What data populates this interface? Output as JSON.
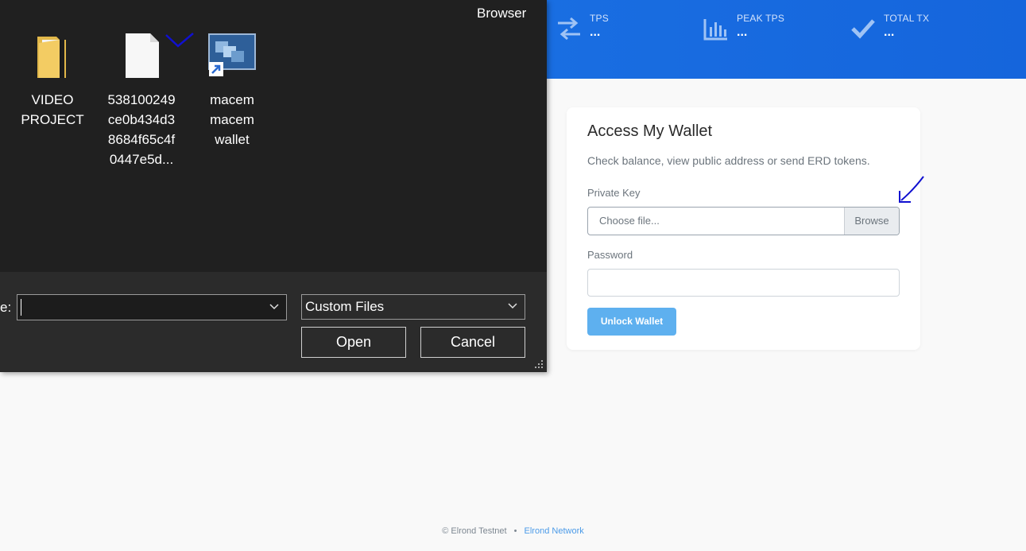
{
  "stats": [
    {
      "label": "TPS",
      "value": "..."
    },
    {
      "label": "PEAK TPS",
      "value": "..."
    },
    {
      "label": "TOTAL TX",
      "value": "..."
    }
  ],
  "wallet": {
    "title": "Access My Wallet",
    "description": "Check balance, view public address or send ERD tokens.",
    "private_key_label": "Private Key",
    "file_placeholder": "Choose file...",
    "browse_label": "Browse",
    "password_label": "Password",
    "unlock_label": "Unlock Wallet"
  },
  "footer": {
    "copyright": "© Elrond Testnet",
    "separator": "•",
    "network_link": "Elrond Network"
  },
  "dialog": {
    "browser_label": "Browser",
    "files": [
      {
        "icon": "folder-icon",
        "lines": [
          "VIDEO",
          "PROJECT"
        ]
      },
      {
        "icon": "file-icon",
        "lines": [
          "538100249",
          "ce0b434d3",
          "8684f65c4f",
          "0447e5d..."
        ]
      },
      {
        "icon": "shortcut-app-icon",
        "lines": [
          "macem",
          "macem",
          "wallet"
        ]
      }
    ],
    "filename_label": "e:",
    "filename_value": "",
    "filetype_selected": "Custom Files",
    "open_label": "Open",
    "cancel_label": "Cancel"
  },
  "colors": {
    "banner": "#1e78e8",
    "unlock_button": "#5eb0ef",
    "dialog_bg": "#202020",
    "annotation": "#1010d0"
  }
}
